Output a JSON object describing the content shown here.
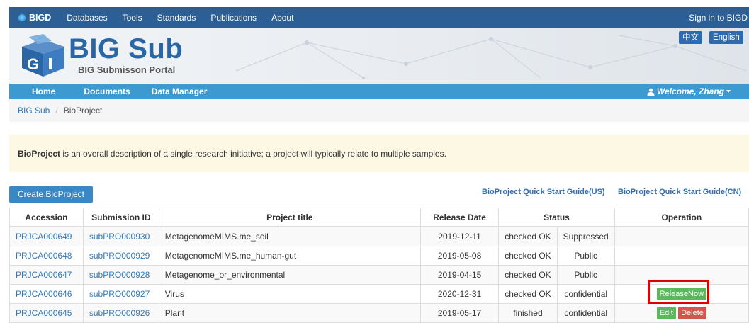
{
  "topnav": {
    "brand": "BIGD",
    "items": [
      "Databases",
      "Tools",
      "Standards",
      "Publications",
      "About"
    ],
    "signin": "Sign in to BIGD"
  },
  "header": {
    "title": "BIG Sub",
    "subtitle": "BIG Submisson Portal",
    "lang_zh": "中文",
    "lang_en": "English"
  },
  "menu": {
    "home": "Home",
    "documents": "Documents",
    "data_manager": "Data Manager",
    "welcome": "Welcome, Zhang"
  },
  "breadcrumb": {
    "root": "BIG Sub",
    "current": "BioProject"
  },
  "info": {
    "bold": "BioProject",
    "text": " is an overall description of a single research initiative; a project will typically relate to multiple samples."
  },
  "actions": {
    "create": "Create BioProject",
    "guide_us": "BioProject Quick Start Guide(US)",
    "guide_cn": "BioProject Quick Start Guide(CN)"
  },
  "table": {
    "headers": {
      "accession": "Accession",
      "submission": "Submission ID",
      "title": "Project title",
      "release": "Release Date",
      "status": "Status",
      "operation": "Operation"
    },
    "rows": [
      {
        "accession": "PRJCA000649",
        "submission": "subPRO000930",
        "title": "MetagenomeMIMS.me_soil",
        "release": "2019-12-11",
        "check": "checked OK",
        "status": "Suppressed"
      },
      {
        "accession": "PRJCA000648",
        "submission": "subPRO000929",
        "title": "MetagenomeMIMS.me_human-gut",
        "release": "2019-05-08",
        "check": "checked OK",
        "status": "Public"
      },
      {
        "accession": "PRJCA000647",
        "submission": "subPRO000928",
        "title": "Metagenome_or_environmental",
        "release": "2019-04-15",
        "check": "checked OK",
        "status": "Public"
      },
      {
        "accession": "PRJCA000646",
        "submission": "subPRO000927",
        "title": "Virus",
        "release": "2020-12-31",
        "check": "checked OK",
        "status": "confidential",
        "op_release": "ReleaseNow"
      },
      {
        "accession": "PRJCA000645",
        "submission": "subPRO000926",
        "title": "Plant",
        "release": "2019-05-17",
        "check": "finished",
        "status": "confidential",
        "op_edit": "Edit",
        "op_delete": "Delete"
      }
    ]
  },
  "colors": {
    "topnav": "#2c5f96",
    "menubar": "#3d9ad1",
    "link": "#337ab7",
    "info_bg": "#fcf8e3",
    "highlight": "#e00000"
  }
}
